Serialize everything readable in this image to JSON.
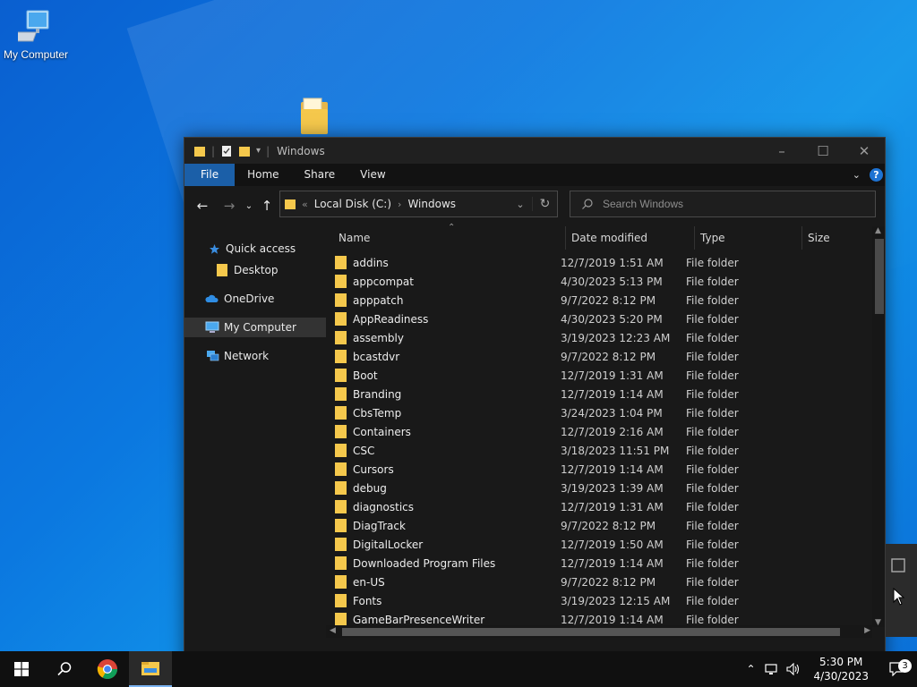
{
  "desktop": {
    "icons": [
      {
        "label": "My Computer",
        "icon": "computer-icon"
      }
    ]
  },
  "window": {
    "title": "Windows",
    "ribbon_tabs": [
      "File",
      "Home",
      "Share",
      "View"
    ],
    "address": {
      "drive": "Local Disk (C:)",
      "folder": "Windows"
    },
    "search_placeholder": "Search Windows",
    "columns": [
      "Name",
      "Date modified",
      "Type",
      "Size"
    ],
    "nav": [
      {
        "label": "Quick access",
        "icon": "star-icon"
      },
      {
        "label": "Desktop",
        "icon": "folder-icon"
      },
      {
        "label": "OneDrive",
        "icon": "cloud-icon"
      },
      {
        "label": "My Computer",
        "icon": "computer-icon"
      },
      {
        "label": "Network",
        "icon": "network-icon"
      }
    ],
    "files": [
      {
        "name": "addins",
        "date": "12/7/2019 1:51 AM",
        "type": "File folder"
      },
      {
        "name": "appcompat",
        "date": "4/30/2023 5:13 PM",
        "type": "File folder"
      },
      {
        "name": "apppatch",
        "date": "9/7/2022 8:12 PM",
        "type": "File folder"
      },
      {
        "name": "AppReadiness",
        "date": "4/30/2023 5:20 PM",
        "type": "File folder"
      },
      {
        "name": "assembly",
        "date": "3/19/2023 12:23 AM",
        "type": "File folder"
      },
      {
        "name": "bcastdvr",
        "date": "9/7/2022 8:12 PM",
        "type": "File folder"
      },
      {
        "name": "Boot",
        "date": "12/7/2019 1:31 AM",
        "type": "File folder"
      },
      {
        "name": "Branding",
        "date": "12/7/2019 1:14 AM",
        "type": "File folder"
      },
      {
        "name": "CbsTemp",
        "date": "3/24/2023 1:04 PM",
        "type": "File folder"
      },
      {
        "name": "Containers",
        "date": "12/7/2019 2:16 AM",
        "type": "File folder"
      },
      {
        "name": "CSC",
        "date": "3/18/2023 11:51 PM",
        "type": "File folder"
      },
      {
        "name": "Cursors",
        "date": "12/7/2019 1:14 AM",
        "type": "File folder"
      },
      {
        "name": "debug",
        "date": "3/19/2023 1:39 AM",
        "type": "File folder"
      },
      {
        "name": "diagnostics",
        "date": "12/7/2019 1:31 AM",
        "type": "File folder"
      },
      {
        "name": "DiagTrack",
        "date": "9/7/2022 8:12 PM",
        "type": "File folder"
      },
      {
        "name": "DigitalLocker",
        "date": "12/7/2019 1:50 AM",
        "type": "File folder"
      },
      {
        "name": "Downloaded Program Files",
        "date": "12/7/2019 1:14 AM",
        "type": "File folder"
      },
      {
        "name": "en-US",
        "date": "9/7/2022 8:12 PM",
        "type": "File folder"
      },
      {
        "name": "Fonts",
        "date": "3/19/2023 12:15 AM",
        "type": "File folder"
      },
      {
        "name": "GameBarPresenceWriter",
        "date": "12/7/2019 1:14 AM",
        "type": "File folder"
      }
    ]
  },
  "taskbar": {
    "time": "5:30 PM",
    "date": "4/30/2023",
    "notification_count": "3"
  },
  "colors": {
    "accent": "#1b5fa8",
    "window_bg": "#191919",
    "folder": "#f5c84c"
  }
}
